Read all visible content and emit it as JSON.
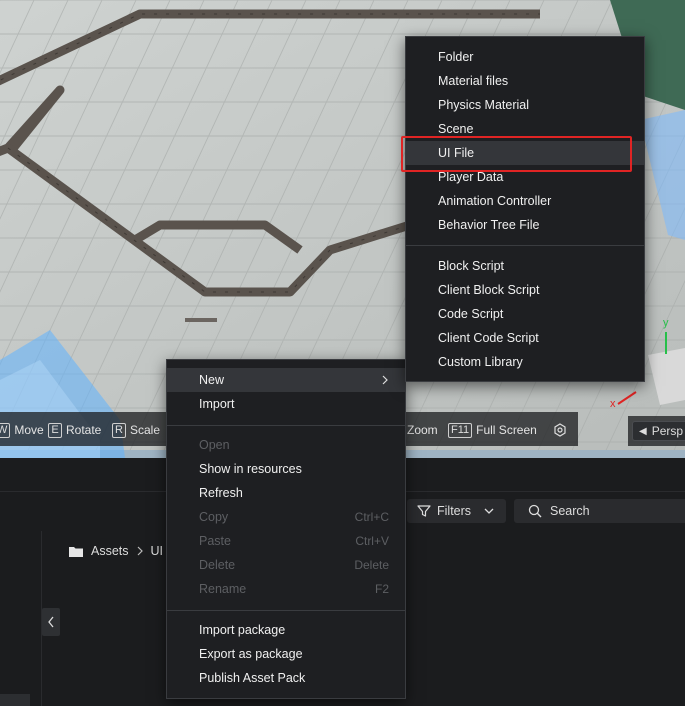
{
  "viewport": {
    "tools": [
      {
        "key": "W",
        "label": "Move"
      },
      {
        "key": "E",
        "label": "Rotate"
      },
      {
        "key": "R",
        "label": "Scale"
      }
    ],
    "zoom_label": "Zoom",
    "fullscreen": {
      "key": "F11",
      "label": "Full Screen"
    },
    "perspective_label": "Persp",
    "gizmo": {
      "y_axis": "y",
      "x_axis": "x"
    }
  },
  "panel": {
    "filters_label": "Filters",
    "search_placeholder": "Search",
    "breadcrumb": [
      "Assets",
      "UI"
    ]
  },
  "context_menu": {
    "items": [
      {
        "label": "New",
        "shortcut": "",
        "enabled": true,
        "has_submenu": true
      },
      {
        "label": "Import",
        "shortcut": "",
        "enabled": true
      },
      {
        "label": "Open",
        "shortcut": "",
        "enabled": false
      },
      {
        "label": "Show in resources",
        "shortcut": "",
        "enabled": true
      },
      {
        "label": "Refresh",
        "shortcut": "",
        "enabled": true
      },
      {
        "label": "Copy",
        "shortcut": "Ctrl+C",
        "enabled": false
      },
      {
        "label": "Paste",
        "shortcut": "Ctrl+V",
        "enabled": false
      },
      {
        "label": "Delete",
        "shortcut": "Delete",
        "enabled": false
      },
      {
        "label": "Rename",
        "shortcut": "F2",
        "enabled": false
      },
      {
        "label": "Import package",
        "shortcut": "",
        "enabled": true
      },
      {
        "label": "Export as package",
        "shortcut": "",
        "enabled": true
      },
      {
        "label": "Publish Asset Pack",
        "shortcut": "",
        "enabled": true
      }
    ]
  },
  "new_submenu": {
    "items": [
      {
        "label": "Folder"
      },
      {
        "label": "Material files"
      },
      {
        "label": "Physics Material"
      },
      {
        "label": "Scene"
      },
      {
        "label": "UI File",
        "highlighted": true
      },
      {
        "label": "Player Data"
      },
      {
        "label": "Animation Controller"
      },
      {
        "label": "Behavior Tree File"
      },
      {
        "label": "Block Script"
      },
      {
        "label": "Client Block Script"
      },
      {
        "label": "Code Script"
      },
      {
        "label": "Client Code Script"
      },
      {
        "label": "Custom Library"
      }
    ]
  },
  "colors": {
    "highlight_border": "#e02424",
    "menu_bg": "#1e1f22",
    "glow": "#3aa0ff"
  }
}
